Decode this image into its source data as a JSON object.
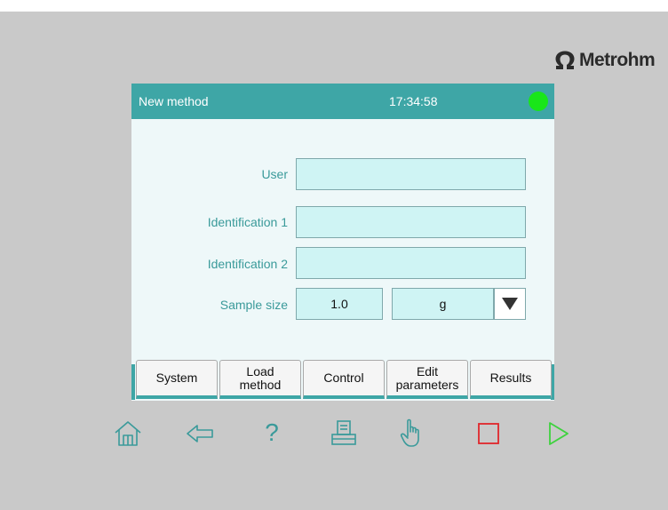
{
  "brand": {
    "logo_text": "Metrohm"
  },
  "screen": {
    "title": "New method",
    "clock": "17:34:58",
    "status_color": "#19e619"
  },
  "form": {
    "user": {
      "label": "User",
      "value": ""
    },
    "identification1": {
      "label": "Identification 1",
      "value": ""
    },
    "identification2": {
      "label": "Identification 2",
      "value": ""
    },
    "sample_size": {
      "label": "Sample size",
      "value": "1.0",
      "unit": "g"
    }
  },
  "tabs": [
    {
      "label": "System"
    },
    {
      "label": "Load\nmethod"
    },
    {
      "label": "Control"
    },
    {
      "label": "Edit\nparameters"
    },
    {
      "label": "Results"
    }
  ],
  "nav_buttons": [
    "home-icon",
    "back-arrow-icon",
    "help-icon",
    "print-icon",
    "manual-control-icon",
    "stop-icon",
    "start-icon"
  ],
  "colors": {
    "accent": "#3ea6a6",
    "field_bg": "#cff4f4",
    "stop": "#e0262a",
    "start": "#3ed23e",
    "nav_icon": "#3a9a9a"
  }
}
